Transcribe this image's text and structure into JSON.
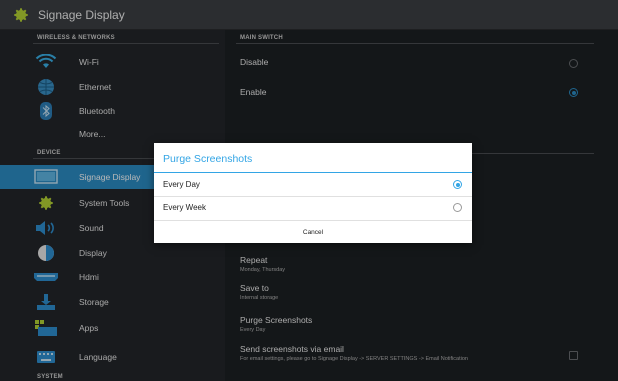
{
  "app": {
    "title": "Signage Display",
    "icon": "gear-icon"
  },
  "sections": {
    "wireless": "WIRELESS & NETWORKS",
    "device": "DEVICE",
    "system": "SYSTEM",
    "main_switch": "MAIN SWITCH"
  },
  "sidebar": {
    "items": [
      {
        "label": "Wi-Fi",
        "icon": "wifi-icon"
      },
      {
        "label": "Ethernet",
        "icon": "ethernet-globe-icon"
      },
      {
        "label": "Bluetooth",
        "icon": "bluetooth-icon"
      },
      {
        "label": "More...",
        "icon": ""
      },
      {
        "label": "Signage Display",
        "icon": "signage-display-icon"
      },
      {
        "label": "System Tools",
        "icon": "gear-icon"
      },
      {
        "label": "Sound",
        "icon": "speaker-icon"
      },
      {
        "label": "Display",
        "icon": "brightness-icon"
      },
      {
        "label": "Hdmi",
        "icon": "hdmi-icon"
      },
      {
        "label": "Storage",
        "icon": "storage-icon"
      },
      {
        "label": "Apps",
        "icon": "apps-icon"
      },
      {
        "label": "Language",
        "icon": "keyboard-icon"
      }
    ],
    "active_index": 4
  },
  "main": {
    "switch_options": [
      {
        "label": "Disable",
        "selected": false
      },
      {
        "label": "Enable",
        "selected": true
      }
    ],
    "settings": [
      {
        "title": "Repeat",
        "subtitle": "Monday, Thursday"
      },
      {
        "title": "Save to",
        "subtitle": "Internal storage"
      },
      {
        "title": "Purge Screenshots",
        "subtitle": "Every Day"
      },
      {
        "title": "Send screenshots via email",
        "subtitle": "For email settings, please go to Signage Display -> SERVER SETTINGS -> Email Notification",
        "checked": false
      }
    ]
  },
  "dialog": {
    "title": "Purge Screenshots",
    "options": [
      {
        "label": "Every Day",
        "selected": true
      },
      {
        "label": "Every Week",
        "selected": false
      }
    ],
    "cancel_label": "Cancel"
  },
  "colors": {
    "accent": "#2b8cc4",
    "dialog_accent": "#33a5e5",
    "background": "#1e2124",
    "action_bar": "#3c3f43"
  }
}
